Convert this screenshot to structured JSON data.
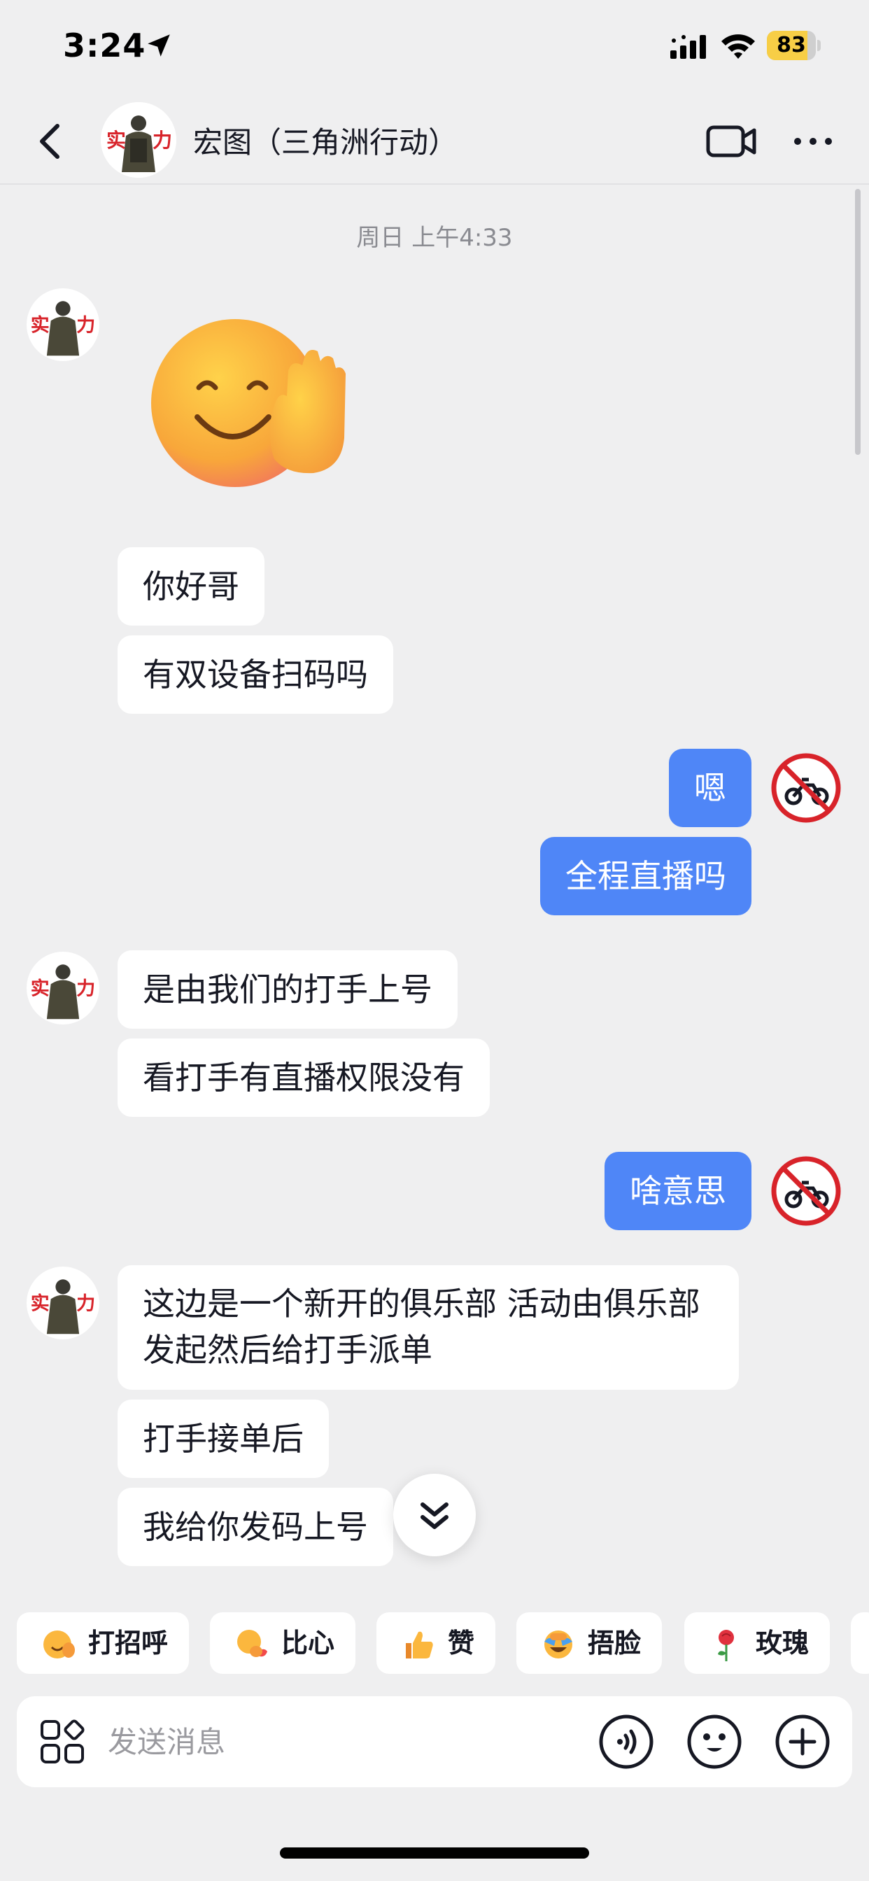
{
  "status_bar": {
    "time": "3:24",
    "battery": "83",
    "battery_level": 0.83,
    "icons": [
      "location-arrow-icon",
      "signal-icon",
      "wifi-icon",
      "battery-icon"
    ]
  },
  "header": {
    "title": "宏图（三角洲行动）",
    "avatar_text": "实力",
    "icons": [
      "back-arrow-icon",
      "video-call-icon",
      "more-icon"
    ]
  },
  "chat": {
    "timestamp": "周日 上午4:33",
    "sticker": "waving-smiley-sticker",
    "messages": [
      {
        "side": "in",
        "text": "你好哥"
      },
      {
        "side": "in",
        "text": "有双设备扫码吗"
      },
      {
        "side": "out",
        "text": "嗯"
      },
      {
        "side": "out",
        "text": "全程直播吗"
      },
      {
        "side": "in",
        "text": "是由我们的打手上号"
      },
      {
        "side": "in",
        "text": "看打手有直播权限没有"
      },
      {
        "side": "out",
        "text": "啥意思"
      },
      {
        "side": "in",
        "text": "这边是一个新开的俱乐部 活动由俱乐部发起然后给打手派单"
      },
      {
        "side": "in",
        "text": "打手接单后"
      },
      {
        "side": "in",
        "text": "我给你发码上号"
      }
    ],
    "self_avatar": "no-motorcycle-icon"
  },
  "quick_replies": [
    {
      "label": "打招呼",
      "icon": "waving-face-emoji"
    },
    {
      "label": "比心",
      "icon": "finger-heart-emoji"
    },
    {
      "label": "赞",
      "icon": "thumbs-up-emoji"
    },
    {
      "label": "捂脸",
      "icon": "facepalm-laugh-emoji"
    },
    {
      "label": "玫瑰",
      "icon": "rose-emoji"
    }
  ],
  "input": {
    "placeholder": "发送消息",
    "icons": [
      "apps-icon",
      "voice-icon",
      "emoji-icon",
      "plus-icon"
    ]
  },
  "colors": {
    "background": "#efeff0",
    "outgoing_bubble": "#4f86f7",
    "incoming_bubble": "#ffffff",
    "battery": "#f7ce46"
  }
}
